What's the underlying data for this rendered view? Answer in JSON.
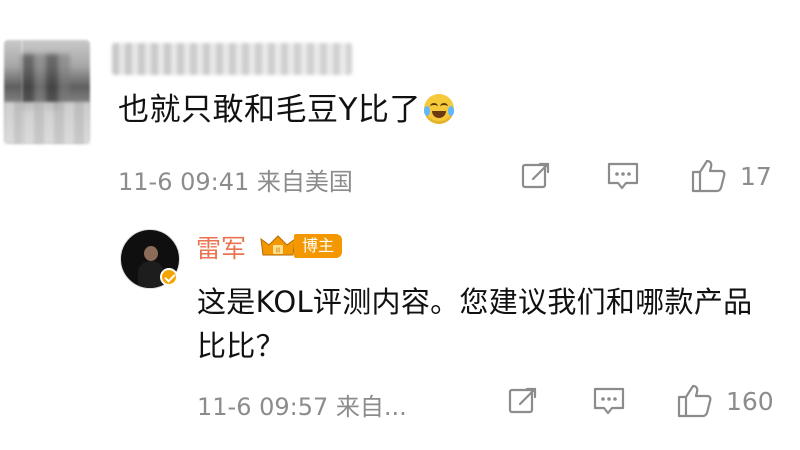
{
  "comment": {
    "username_visible": "8434545",
    "text": "也就只敢和毛豆Y比了",
    "emoji": "laughing-with-tears-emoji",
    "meta": "11-6 09:41 来自美国",
    "actions": {
      "like_count": "17"
    }
  },
  "reply": {
    "author": "雷军",
    "badge_label": "博主",
    "text": "这是KOL评测内容。您建议我们和哪款产品比比？",
    "meta": "11-6 09:57 来自...",
    "actions": {
      "like_count": "160"
    }
  },
  "colors": {
    "author_name": "#eb7350",
    "badge_bg": "#f39800",
    "muted_text": "#8c8c8c"
  }
}
